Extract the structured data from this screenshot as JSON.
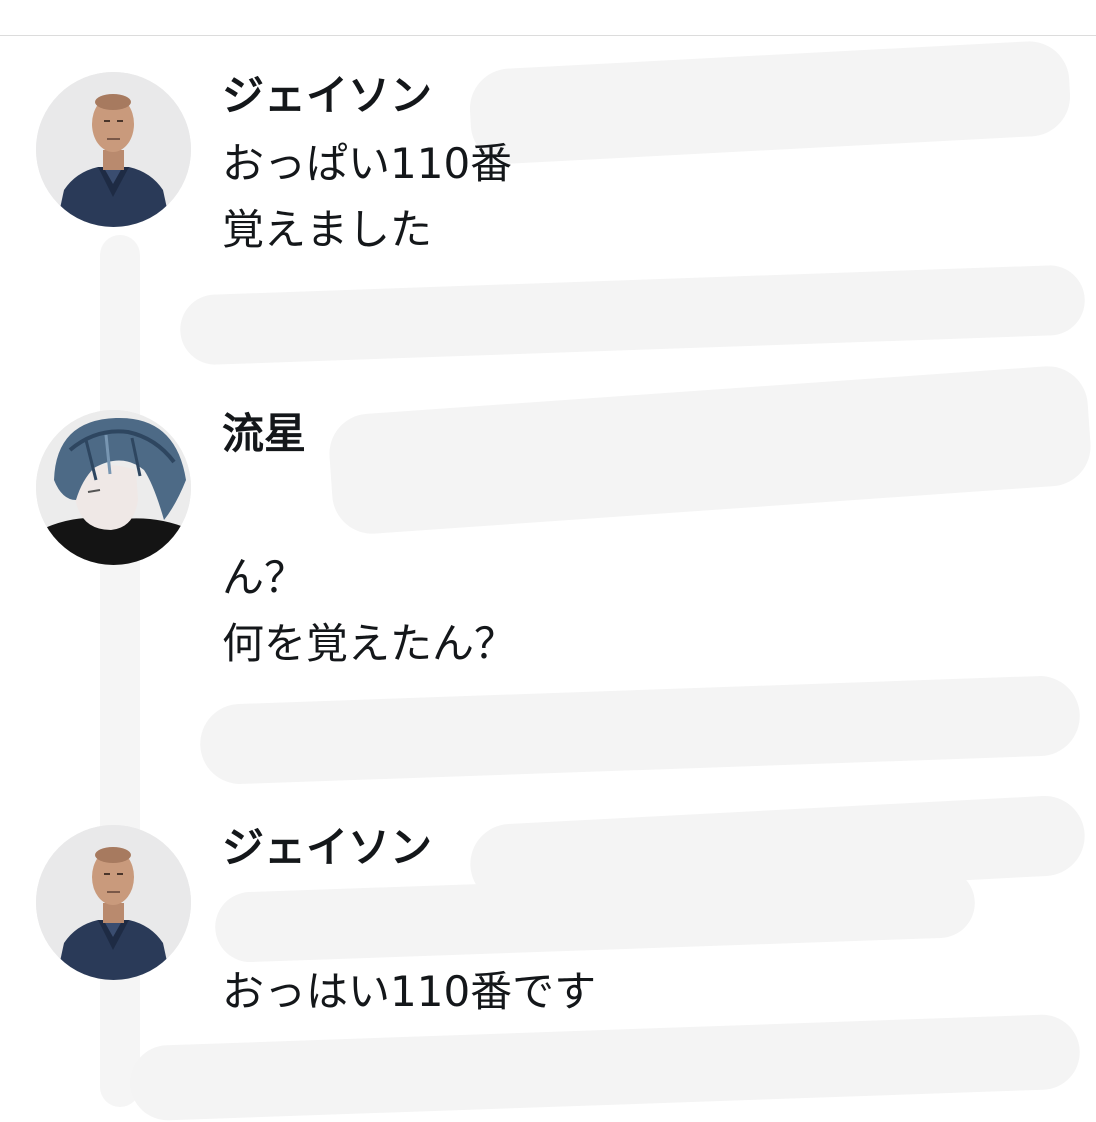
{
  "posts": [
    {
      "username": "ジェイソン",
      "avatar_icon": "bald-man-avatar-icon",
      "lines": [
        "おっぱい110番",
        "覚えました"
      ]
    },
    {
      "username": "流星",
      "avatar_icon": "blue-hair-anime-boy-avatar-icon",
      "lines": [
        "ん？",
        "何を覚えたん？"
      ]
    },
    {
      "username": "ジェイソン",
      "avatar_icon": "bald-man-avatar-icon",
      "lines": [
        "おっはい110番です"
      ]
    }
  ]
}
